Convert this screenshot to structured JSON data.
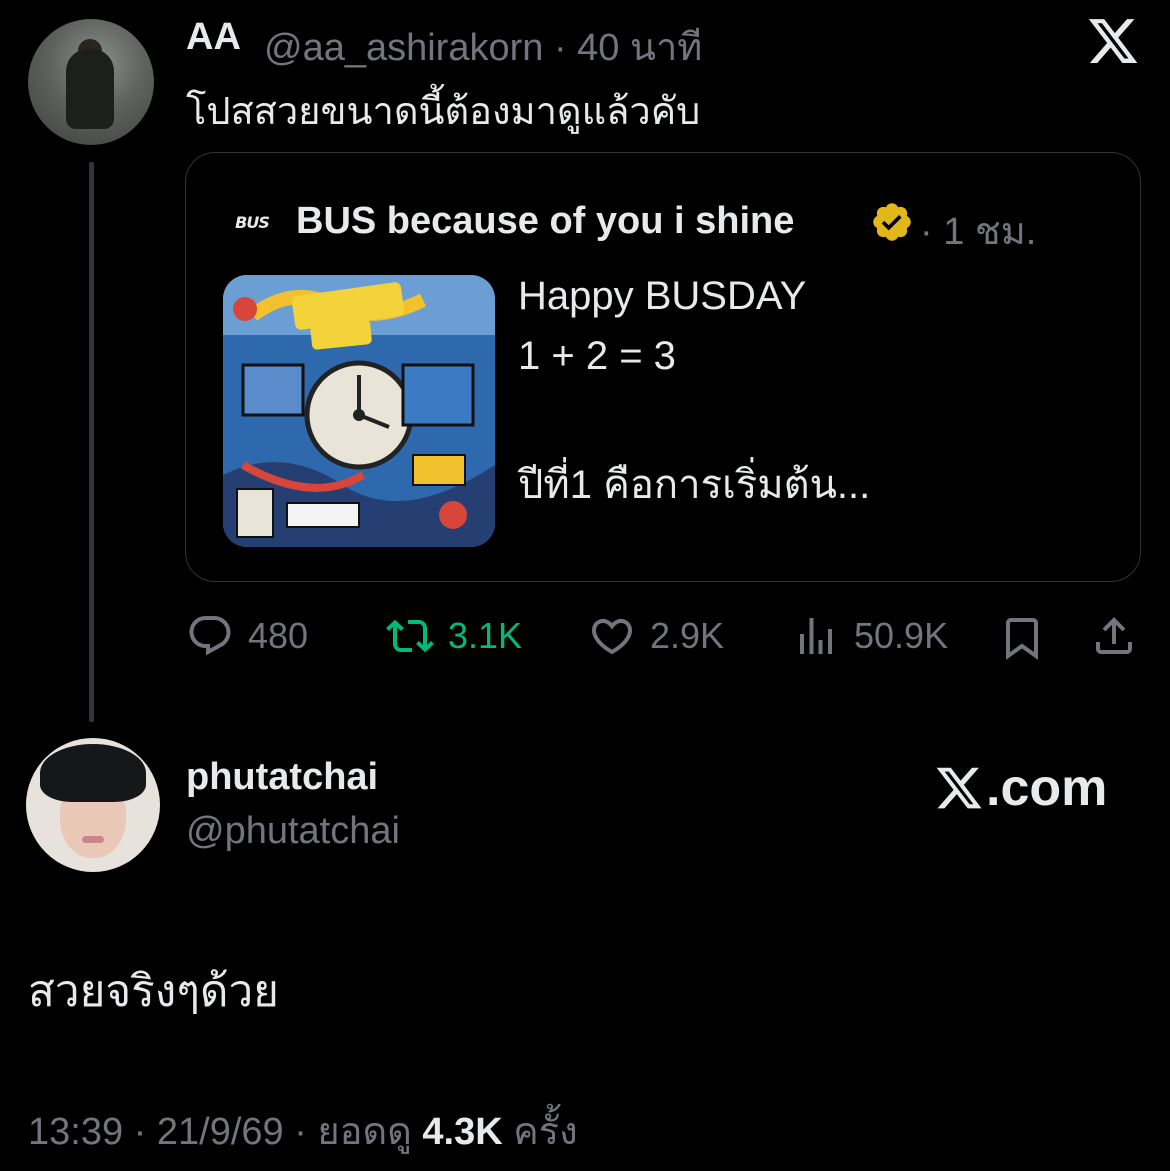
{
  "parent_tweet": {
    "display_name": "AA",
    "meta": "@aa_ashirakorn · 40 นาที",
    "text": "โปสสวยขนาดนี้ต้องมาดูแล้วคับ",
    "quote": {
      "display_name": "BUS because of you i shine",
      "time": "· 1 ชม.",
      "lines": [
        "Happy BUSDAY",
        "1 + 2 = 3",
        "ปีที่1 คือการเริ่มต้น..."
      ],
      "logo_text": "BUS"
    },
    "actions": {
      "reply_count": "480",
      "retweet_count": "3.1K",
      "like_count": "2.9K",
      "view_count": "50.9K"
    }
  },
  "reply_tweet": {
    "display_name": "phutatchai",
    "handle": "@phutatchai",
    "text": "สวยจริงๆด้วย",
    "time_date": "13:39 · 21/9/69 · ยอดดู",
    "views": "4.3K",
    "views_suffix": "ครั้ง"
  },
  "branding": {
    "watermark": ".com"
  },
  "colors": {
    "background": "#000000",
    "text": "#e7e9ea",
    "muted": "#71767b",
    "retweet_active": "#00ba7c",
    "verified_gold": "#e2b719"
  },
  "icons": [
    "x-logo-icon",
    "verified-badge-icon",
    "reply-icon",
    "retweet-icon",
    "like-icon",
    "views-icon",
    "bookmark-icon",
    "share-icon"
  ]
}
